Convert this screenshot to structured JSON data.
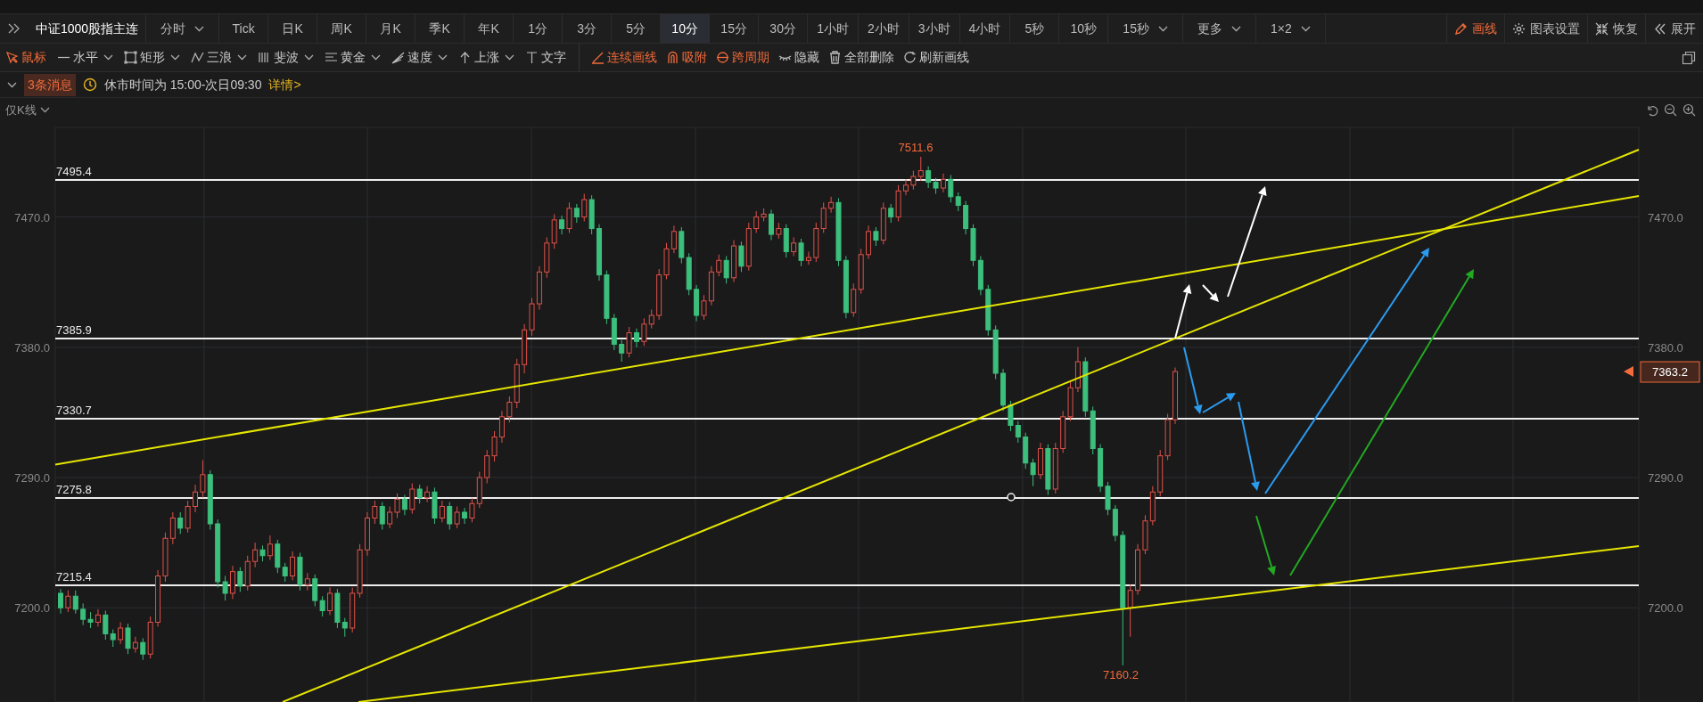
{
  "period_bar": {
    "symbol": "中证1000股指主连",
    "periods": [
      {
        "label": "分时",
        "dropdown": true,
        "selected": false
      },
      {
        "label": "Tick",
        "dropdown": false,
        "selected": false
      },
      {
        "label": "日K",
        "dropdown": false,
        "selected": false
      },
      {
        "label": "周K",
        "dropdown": false,
        "selected": false
      },
      {
        "label": "月K",
        "dropdown": false,
        "selected": false
      },
      {
        "label": "季K",
        "dropdown": false,
        "selected": false
      },
      {
        "label": "年K",
        "dropdown": false,
        "selected": false
      },
      {
        "label": "1分",
        "dropdown": false,
        "selected": false
      },
      {
        "label": "3分",
        "dropdown": false,
        "selected": false
      },
      {
        "label": "5分",
        "dropdown": false,
        "selected": false
      },
      {
        "label": "10分",
        "dropdown": false,
        "selected": true
      },
      {
        "label": "15分",
        "dropdown": false,
        "selected": false
      },
      {
        "label": "30分",
        "dropdown": false,
        "selected": false
      },
      {
        "label": "1小时",
        "dropdown": false,
        "selected": false
      },
      {
        "label": "2小时",
        "dropdown": false,
        "selected": false
      },
      {
        "label": "3小时",
        "dropdown": false,
        "selected": false
      },
      {
        "label": "4小时",
        "dropdown": false,
        "selected": false
      },
      {
        "label": "5秒",
        "dropdown": false,
        "selected": false
      },
      {
        "label": "10秒",
        "dropdown": false,
        "selected": false
      },
      {
        "label": "15秒",
        "dropdown": true,
        "selected": false
      },
      {
        "label": "更多",
        "dropdown": true,
        "selected": false
      },
      {
        "label": "1×2",
        "dropdown": true,
        "selected": false
      }
    ],
    "actions": [
      {
        "label": "画线",
        "active": true
      },
      {
        "label": "图表设置",
        "active": false
      },
      {
        "label": "恢复",
        "active": false
      },
      {
        "label": "展开",
        "active": false
      }
    ]
  },
  "draw_toolbar": {
    "tools": [
      {
        "label": "鼠标",
        "dropdown": false,
        "selected": true
      },
      {
        "label": "水平",
        "dropdown": true,
        "selected": false
      },
      {
        "label": "矩形",
        "dropdown": true,
        "selected": false
      },
      {
        "label": "三浪",
        "dropdown": true,
        "selected": false
      },
      {
        "label": "斐波",
        "dropdown": true,
        "selected": false
      },
      {
        "label": "黄金",
        "dropdown": true,
        "selected": false
      },
      {
        "label": "速度",
        "dropdown": true,
        "selected": false
      },
      {
        "label": "上涨",
        "dropdown": true,
        "selected": false
      },
      {
        "label": "文字",
        "dropdown": false,
        "selected": false
      }
    ],
    "options": [
      {
        "label": "连续画线",
        "on": true
      },
      {
        "label": "吸附",
        "on": true
      },
      {
        "label": "跨周期",
        "on": true
      },
      {
        "label": "隐藏",
        "on": false
      },
      {
        "label": "全部删除",
        "on": false
      },
      {
        "label": "刷新画线",
        "on": false
      }
    ]
  },
  "notice": {
    "badge": "3条消息",
    "text": "休市时间为 15:00-次日09:30",
    "link": "详情>"
  },
  "chart": {
    "mode": "仅K线",
    "right_axis": [
      "7470.0",
      "7380.0",
      "7290.0",
      "7200.0"
    ],
    "levels": [
      "7495.4",
      "7385.9",
      "7330.7",
      "7275.8",
      "7215.4"
    ],
    "high_label": "7511.6",
    "low_label": "7160.2",
    "last_price": "7363.2",
    "chart_data": {
      "type": "candlestick",
      "ylim": [
        7134.9,
        7531.9
      ],
      "grid": true,
      "yticks": [
        {
          "value": 7200,
          "label": "7200.0"
        },
        {
          "value": 7290,
          "label": "7290.0"
        },
        {
          "value": 7380,
          "label": "7380.0"
        },
        {
          "value": 7470,
          "label": "7470.0"
        }
      ],
      "ohlc": [
        [
          7210,
          7213,
          7196,
          7200
        ],
        [
          7200,
          7212,
          7197,
          7208
        ],
        [
          7208,
          7212,
          7196,
          7199
        ],
        [
          7199,
          7203,
          7188,
          7192
        ],
        [
          7192,
          7197,
          7186,
          7190
        ],
        [
          7190,
          7199,
          7187,
          7195
        ],
        [
          7195,
          7198,
          7178,
          7182
        ],
        [
          7182,
          7185,
          7173,
          7178
        ],
        [
          7178,
          7190,
          7175,
          7186
        ],
        [
          7186,
          7189,
          7168,
          7172
        ],
        [
          7172,
          7180,
          7169,
          7176
        ],
        [
          7176,
          7179,
          7164,
          7168
        ],
        [
          7168,
          7194,
          7165,
          7190
        ],
        [
          7190,
          7226,
          7187,
          7222
        ],
        [
          7222,
          7252,
          7218,
          7248
        ],
        [
          7248,
          7266,
          7244,
          7262
        ],
        [
          7262,
          7266,
          7251,
          7255
        ],
        [
          7255,
          7274,
          7252,
          7270
        ],
        [
          7270,
          7285,
          7266,
          7280
        ],
        [
          7280,
          7302,
          7276,
          7292
        ],
        [
          7292,
          7295,
          7254,
          7258
        ],
        [
          7258,
          7261,
          7214,
          7218
        ],
        [
          7218,
          7222,
          7205,
          7210
        ],
        [
          7210,
          7229,
          7206,
          7225
        ],
        [
          7225,
          7228,
          7211,
          7215
        ],
        [
          7215,
          7236,
          7212,
          7232
        ],
        [
          7232,
          7245,
          7228,
          7240
        ],
        [
          7240,
          7243,
          7232,
          7236
        ],
        [
          7236,
          7250,
          7233,
          7244
        ],
        [
          7244,
          7247,
          7224,
          7228
        ],
        [
          7228,
          7231,
          7218,
          7222
        ],
        [
          7222,
          7239,
          7219,
          7235
        ],
        [
          7235,
          7238,
          7212,
          7216
        ],
        [
          7216,
          7224,
          7212,
          7220
        ],
        [
          7220,
          7223,
          7201,
          7205
        ],
        [
          7205,
          7208,
          7194,
          7198
        ],
        [
          7198,
          7214,
          7195,
          7210
        ],
        [
          7210,
          7213,
          7186,
          7190
        ],
        [
          7190,
          7193,
          7180,
          7186
        ],
        [
          7186,
          7214,
          7183,
          7210
        ],
        [
          7210,
          7244,
          7207,
          7240
        ],
        [
          7240,
          7266,
          7236,
          7262
        ],
        [
          7262,
          7274,
          7258,
          7270
        ],
        [
          7270,
          7273,
          7254,
          7258
        ],
        [
          7258,
          7270,
          7255,
          7266
        ],
        [
          7266,
          7279,
          7262,
          7275
        ],
        [
          7275,
          7278,
          7264,
          7268
        ],
        [
          7268,
          7286,
          7265,
          7282
        ],
        [
          7282,
          7285,
          7272,
          7276
        ],
        [
          7276,
          7284,
          7273,
          7280
        ],
        [
          7280,
          7283,
          7258,
          7262
        ],
        [
          7262,
          7274,
          7259,
          7270
        ],
        [
          7270,
          7273,
          7254,
          7258
        ],
        [
          7258,
          7270,
          7255,
          7266
        ],
        [
          7266,
          7269,
          7258,
          7262
        ],
        [
          7262,
          7276,
          7259,
          7272
        ],
        [
          7272,
          7294,
          7269,
          7290
        ],
        [
          7290,
          7309,
          7286,
          7305
        ],
        [
          7305,
          7322,
          7301,
          7318
        ],
        [
          7318,
          7336,
          7314,
          7332
        ],
        [
          7332,
          7346,
          7328,
          7342
        ],
        [
          7342,
          7372,
          7338,
          7368
        ],
        [
          7368,
          7396,
          7362,
          7392
        ],
        [
          7392,
          7414,
          7388,
          7410
        ],
        [
          7410,
          7436,
          7406,
          7432
        ],
        [
          7432,
          7456,
          7428,
          7452
        ],
        [
          7452,
          7472,
          7448,
          7468
        ],
        [
          7468,
          7471,
          7458,
          7462
        ],
        [
          7462,
          7480,
          7459,
          7476
        ],
        [
          7476,
          7479,
          7466,
          7470
        ],
        [
          7470,
          7486,
          7467,
          7482
        ],
        [
          7482,
          7485,
          7458,
          7462
        ],
        [
          7462,
          7465,
          7426,
          7430
        ],
        [
          7430,
          7433,
          7396,
          7400
        ],
        [
          7400,
          7403,
          7378,
          7382
        ],
        [
          7382,
          7385,
          7370,
          7376
        ],
        [
          7376,
          7394,
          7373,
          7390
        ],
        [
          7390,
          7393,
          7380,
          7384
        ],
        [
          7384,
          7400,
          7381,
          7396
        ],
        [
          7396,
          7406,
          7393,
          7402
        ],
        [
          7402,
          7434,
          7399,
          7430
        ],
        [
          7430,
          7452,
          7427,
          7448
        ],
        [
          7448,
          7464,
          7445,
          7460
        ],
        [
          7460,
          7463,
          7438,
          7442
        ],
        [
          7442,
          7445,
          7416,
          7420
        ],
        [
          7420,
          7423,
          7398,
          7402
        ],
        [
          7402,
          7416,
          7399,
          7412
        ],
        [
          7412,
          7436,
          7409,
          7432
        ],
        [
          7432,
          7444,
          7429,
          7440
        ],
        [
          7440,
          7443,
          7424,
          7428
        ],
        [
          7428,
          7454,
          7425,
          7450
        ],
        [
          7450,
          7453,
          7432,
          7436
        ],
        [
          7436,
          7466,
          7433,
          7462
        ],
        [
          7462,
          7474,
          7459,
          7470
        ],
        [
          7470,
          7476,
          7467,
          7472
        ],
        [
          7472,
          7475,
          7454,
          7458
        ],
        [
          7458,
          7466,
          7455,
          7462
        ],
        [
          7462,
          7465,
          7442,
          7446
        ],
        [
          7446,
          7456,
          7443,
          7452
        ],
        [
          7452,
          7455,
          7436,
          7440
        ],
        [
          7440,
          7446,
          7437,
          7442
        ],
        [
          7442,
          7466,
          7439,
          7462
        ],
        [
          7462,
          7480,
          7459,
          7476
        ],
        [
          7476,
          7484,
          7473,
          7480
        ],
        [
          7480,
          7483,
          7436,
          7440
        ],
        [
          7440,
          7443,
          7400,
          7404
        ],
        [
          7404,
          7424,
          7401,
          7420
        ],
        [
          7420,
          7448,
          7417,
          7444
        ],
        [
          7444,
          7464,
          7441,
          7460
        ],
        [
          7460,
          7463,
          7450,
          7454
        ],
        [
          7454,
          7480,
          7451,
          7476
        ],
        [
          7476,
          7479,
          7466,
          7470
        ],
        [
          7470,
          7492,
          7467,
          7488
        ],
        [
          7488,
          7496,
          7485,
          7492
        ],
        [
          7492,
          7502,
          7489,
          7498
        ],
        [
          7498,
          7511.6,
          7495,
          7502
        ],
        [
          7502,
          7505,
          7490,
          7494
        ],
        [
          7494,
          7497,
          7486,
          7490
        ],
        [
          7490,
          7500,
          7487,
          7496
        ],
        [
          7496,
          7499,
          7480,
          7484
        ],
        [
          7484,
          7487,
          7474,
          7478
        ],
        [
          7478,
          7481,
          7458,
          7462
        ],
        [
          7462,
          7465,
          7436,
          7440
        ],
        [
          7440,
          7443,
          7416,
          7420
        ],
        [
          7420,
          7423,
          7388,
          7392
        ],
        [
          7392,
          7395,
          7358,
          7362
        ],
        [
          7362,
          7365,
          7336,
          7340
        ],
        [
          7340,
          7343,
          7322,
          7326
        ],
        [
          7326,
          7329,
          7314,
          7318
        ],
        [
          7318,
          7321,
          7296,
          7300
        ],
        [
          7300,
          7303,
          7284,
          7292
        ],
        [
          7292,
          7314,
          7289,
          7310
        ],
        [
          7310,
          7313,
          7278,
          7282
        ],
        [
          7282,
          7314,
          7279,
          7310
        ],
        [
          7310,
          7336,
          7307,
          7332
        ],
        [
          7332,
          7356,
          7329,
          7352
        ],
        [
          7352,
          7380,
          7349,
          7370
        ],
        [
          7370,
          7373,
          7332,
          7336
        ],
        [
          7336,
          7339,
          7306,
          7310
        ],
        [
          7310,
          7313,
          7280,
          7284
        ],
        [
          7284,
          7287,
          7264,
          7268
        ],
        [
          7268,
          7271,
          7246,
          7250
        ],
        [
          7250,
          7253,
          7160.2,
          7200
        ],
        [
          7200,
          7216,
          7180,
          7212
        ],
        [
          7212,
          7244,
          7209,
          7240
        ],
        [
          7240,
          7264,
          7237,
          7260
        ],
        [
          7260,
          7284,
          7257,
          7280
        ],
        [
          7280,
          7309,
          7277,
          7305
        ],
        [
          7305,
          7334,
          7302,
          7330
        ],
        [
          7330,
          7366,
          7327,
          7363.2
        ]
      ]
    }
  }
}
